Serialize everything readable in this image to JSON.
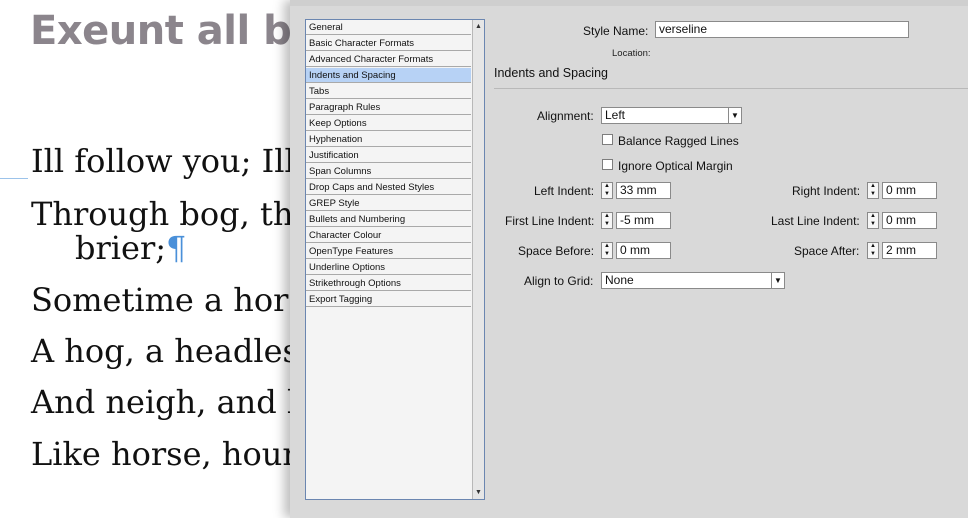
{
  "document": {
    "heading": "Exeunt all bu",
    "lines": [
      "Ill follow you; Ill l",
      "Through bog, thro",
      "brier;",
      "Sometime a horse",
      "A hog, a headless",
      "And neigh, and ba",
      "Like horse, hound"
    ],
    "pilcrow": "¶"
  },
  "dialog": {
    "categories": [
      "General",
      "Basic Character Formats",
      "Advanced Character Formats",
      "Indents and Spacing",
      "Tabs",
      "Paragraph Rules",
      "Keep Options",
      "Hyphenation",
      "Justification",
      "Span Columns",
      "Drop Caps and Nested Styles",
      "GREP Style",
      "Bullets and Numbering",
      "Character Colour",
      "OpenType Features",
      "Underline Options",
      "Strikethrough Options",
      "Export Tagging"
    ],
    "selected_category": "Indents and Spacing",
    "style_name_label": "Style Name:",
    "style_name_value": "verseline",
    "location_label": "Location:",
    "section_title": "Indents and Spacing",
    "alignment_label": "Alignment:",
    "alignment_value": "Left",
    "balance_ragged_label": "Balance Ragged Lines",
    "ignore_optical_label": "Ignore Optical Margin",
    "left_indent_label": "Left Indent:",
    "left_indent_value": "33 mm",
    "right_indent_label": "Right Indent:",
    "right_indent_value": "0 mm",
    "first_line_label": "First Line Indent:",
    "first_line_value": "-5 mm",
    "last_line_label": "Last Line Indent:",
    "last_line_value": "0 mm",
    "space_before_label": "Space Before:",
    "space_before_value": "0 mm",
    "space_after_label": "Space After:",
    "space_after_value": "2 mm",
    "align_grid_label": "Align to Grid:",
    "align_grid_value": "None"
  }
}
